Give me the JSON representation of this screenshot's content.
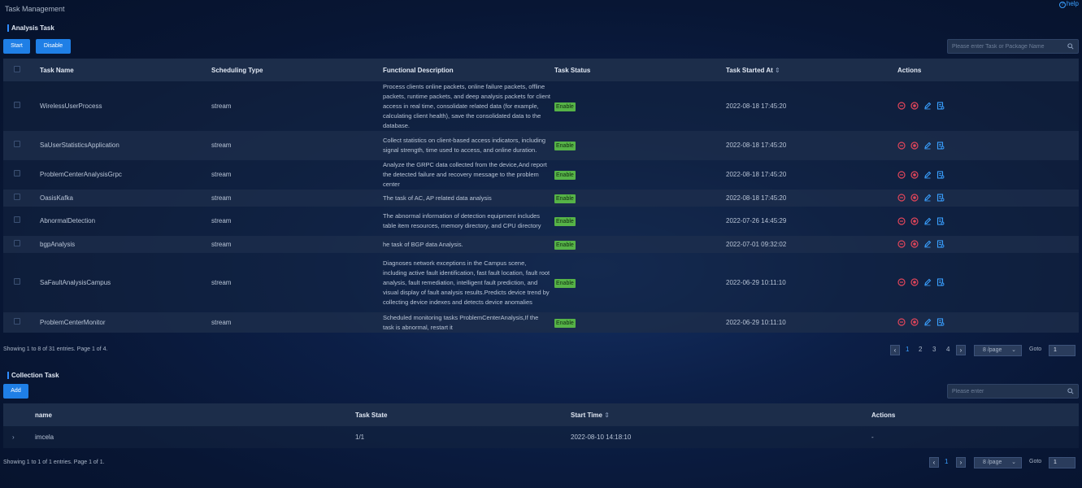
{
  "page": {
    "title": "Task Management",
    "help": "help"
  },
  "analysis": {
    "title": "Analysis Task",
    "start_label": "Start",
    "disable_label": "Disable",
    "search_placeholder": "Please enter Task or Package Name",
    "columns": [
      "Task Name",
      "Scheduling Type",
      "Functional Description",
      "Task Status",
      "Task Started At",
      "Actions"
    ],
    "sort_icon": "⇕",
    "rows": [
      {
        "name": "WirelessUserProcess",
        "type": "stream",
        "desc": "Process clients online packets, online failure packets, offline packets, runtime packets, and deep analysis packets for client access in real time, consolidate related data (for example, calculating client health), save the consolidated data to the database.",
        "status": "Enable",
        "started": "2022-08-18 17:45:20"
      },
      {
        "name": "SaUserStatisticsApplication",
        "type": "stream",
        "desc": "Collect statistics on client-based access indicators, including signal strength, time used to access, and online duration.",
        "status": "Enable",
        "started": "2022-08-18 17:45:20"
      },
      {
        "name": "ProblemCenterAnalysisGrpc",
        "type": "stream",
        "desc": "Analyze the GRPC data collected from the device,And report the detected failure and recovery message to the problem center",
        "status": "Enable",
        "started": "2022-08-18 17:45:20"
      },
      {
        "name": "OasisKafka",
        "type": "stream",
        "desc": "The task of AC, AP related data analysis",
        "status": "Enable",
        "started": "2022-08-18 17:45:20"
      },
      {
        "name": "AbnormalDetection",
        "type": "stream",
        "desc": "The abnormal information of detection equipment includes table item resources, memory directory, and CPU directory",
        "status": "Enable",
        "started": "2022-07-26 14:45:29"
      },
      {
        "name": "bgpAnalysis",
        "type": "stream",
        "desc": "he task of BGP data Analysis.",
        "status": "Enable",
        "started": "2022-07-01 09:32:02"
      },
      {
        "name": "SaFaultAnalysisCampus",
        "type": "stream",
        "desc": "Diagnoses network exceptions in the Campus scene, including active fault identification, fast fault location, fault root analysis, fault remediation, intelligent fault prediction, and visual display of fault analysis results.Predicts device trend by collecting device indexes and detects device anomalies",
        "status": "Enable",
        "started": "2022-06-29 10:11:10"
      },
      {
        "name": "ProblemCenterMonitor",
        "type": "stream",
        "desc": "Scheduled monitoring tasks ProblemCenterAnalysis,If the task is abnormal, restart it",
        "status": "Enable",
        "started": "2022-06-29 10:11:10"
      }
    ],
    "footer": "Showing 1 to 8 of 31 entries.  Page 1 of 4.",
    "pagination": {
      "prev": "‹",
      "next": "›",
      "pages": [
        "1",
        "2",
        "3",
        "4"
      ],
      "current": "1",
      "per_page": "8 /page",
      "goto_label": "Goto",
      "goto_value": "1"
    }
  },
  "collection": {
    "title": "Collection Task",
    "add_label": "Add",
    "search_placeholder": "Please enter",
    "columns": [
      "name",
      "Task State",
      "Start Time",
      "Actions"
    ],
    "sort_icon": "⇕",
    "rows": [
      {
        "expand": "›",
        "name": "imcela",
        "state": "1/1",
        "start": "2022-08-10 14:18:10",
        "actions": "-"
      }
    ],
    "footer": "Showing 1 to 1 of 1 entries.  Page 1 of 1.",
    "pagination": {
      "prev": "‹",
      "next": "›",
      "pages": [
        "1"
      ],
      "current": "1",
      "per_page": "8 /page",
      "goto_label": "Goto",
      "goto_value": "1"
    }
  },
  "colors": {
    "accent": "#1f7fe6",
    "enable": "#56b347",
    "danger": "#e0455a",
    "link": "#3aa0ff"
  }
}
